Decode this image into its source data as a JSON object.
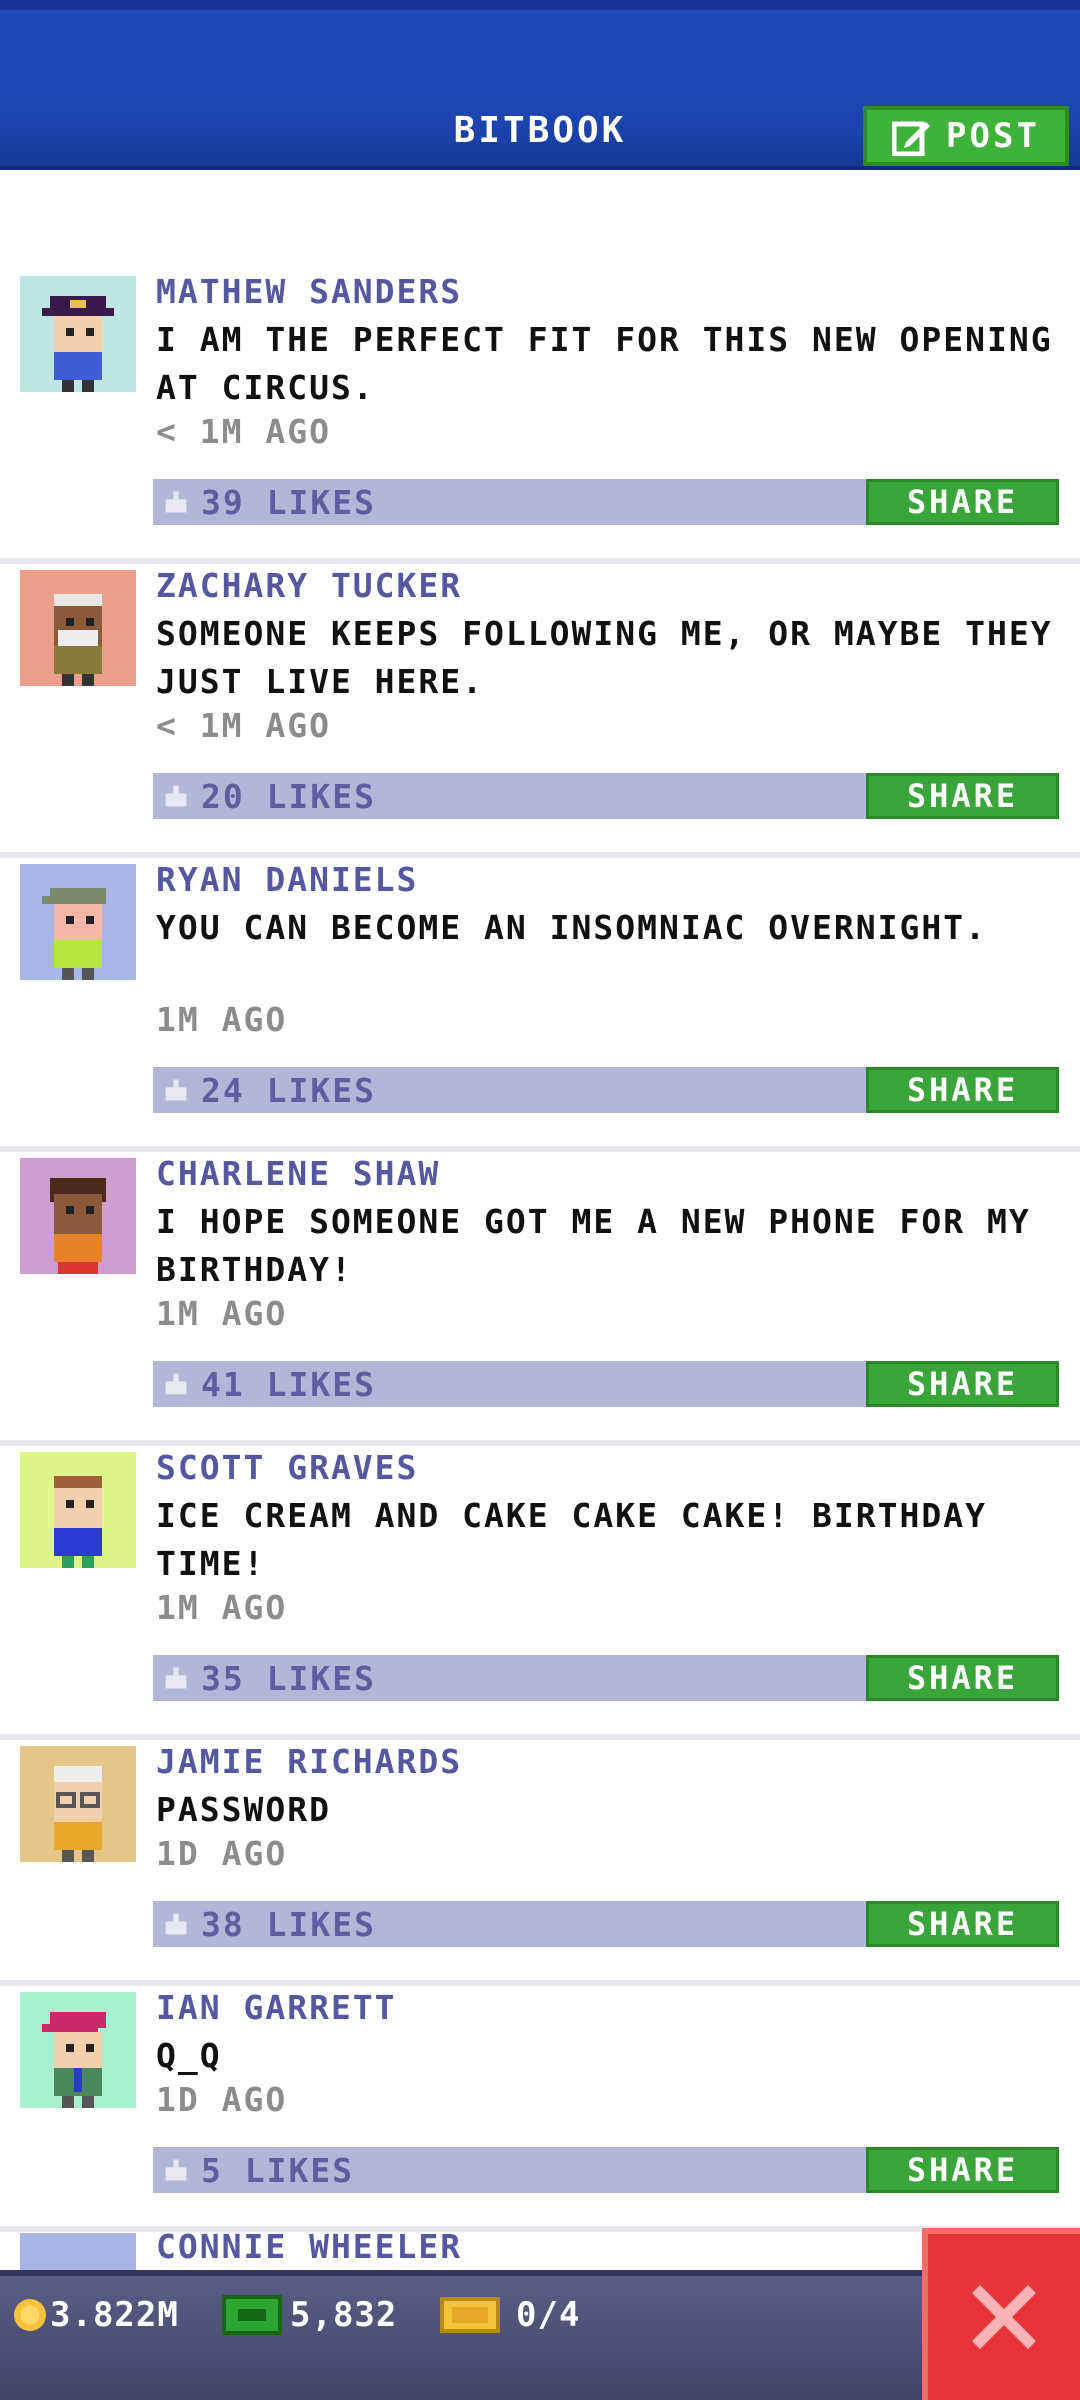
{
  "header": {
    "title": "BITBOOK",
    "post_label": "POST"
  },
  "feed": {
    "posts": [
      {
        "name": "MATHEW SANDERS",
        "text": "I AM THE PERFECT FIT FOR THIS NEW OPENING AT CIRCUS.",
        "time": "< 1M AGO",
        "likes": "39 LIKES",
        "share": "SHARE",
        "avatar_bg": "#c0e6e3"
      },
      {
        "name": "ZACHARY TUCKER",
        "text": "SOMEONE KEEPS FOLLOWING ME, OR MAYBE THEY JUST LIVE HERE.",
        "time": "< 1M AGO",
        "likes": "20 LIKES",
        "share": "SHARE",
        "avatar_bg": "#ec9f8b"
      },
      {
        "name": "RYAN DANIELS",
        "text": "YOU CAN BECOME AN INSOMNIAC OVERNIGHT.",
        "time": "1M AGO",
        "likes": "24 LIKES",
        "share": "SHARE",
        "avatar_bg": "#a8b6e8"
      },
      {
        "name": "CHARLENE SHAW",
        "text": "I HOPE SOMEONE GOT ME A NEW PHONE FOR MY BIRTHDAY!",
        "time": "1M AGO",
        "likes": "41 LIKES",
        "share": "SHARE",
        "avatar_bg": "#cc9ecf"
      },
      {
        "name": "SCOTT GRAVES",
        "text": "ICE CREAM AND CAKE CAKE CAKE! BIRTHDAY TIME!",
        "time": "1M AGO",
        "likes": "35 LIKES",
        "share": "SHARE",
        "avatar_bg": "#def58c"
      },
      {
        "name": "JAMIE RICHARDS",
        "text": "PASSWORD",
        "time": "1D AGO",
        "likes": "38 LIKES",
        "share": "SHARE",
        "avatar_bg": "#e5c588"
      },
      {
        "name": "IAN GARRETT",
        "text": "Q_Q",
        "time": "1D AGO",
        "likes": "5 LIKES",
        "share": "SHARE",
        "avatar_bg": "#a8f0cf"
      }
    ],
    "partial_post_name": "CONNIE WHEELER"
  },
  "bottom_bar": {
    "coins": "3.822M",
    "bux": "5,832",
    "vip": "0/4"
  },
  "colors": {
    "header_blue": "#1d45b0",
    "share_green": "#3aa53a",
    "likes_bar": "#b3b7d7",
    "name_purple": "#5558a0",
    "close_red": "#e7333a"
  }
}
